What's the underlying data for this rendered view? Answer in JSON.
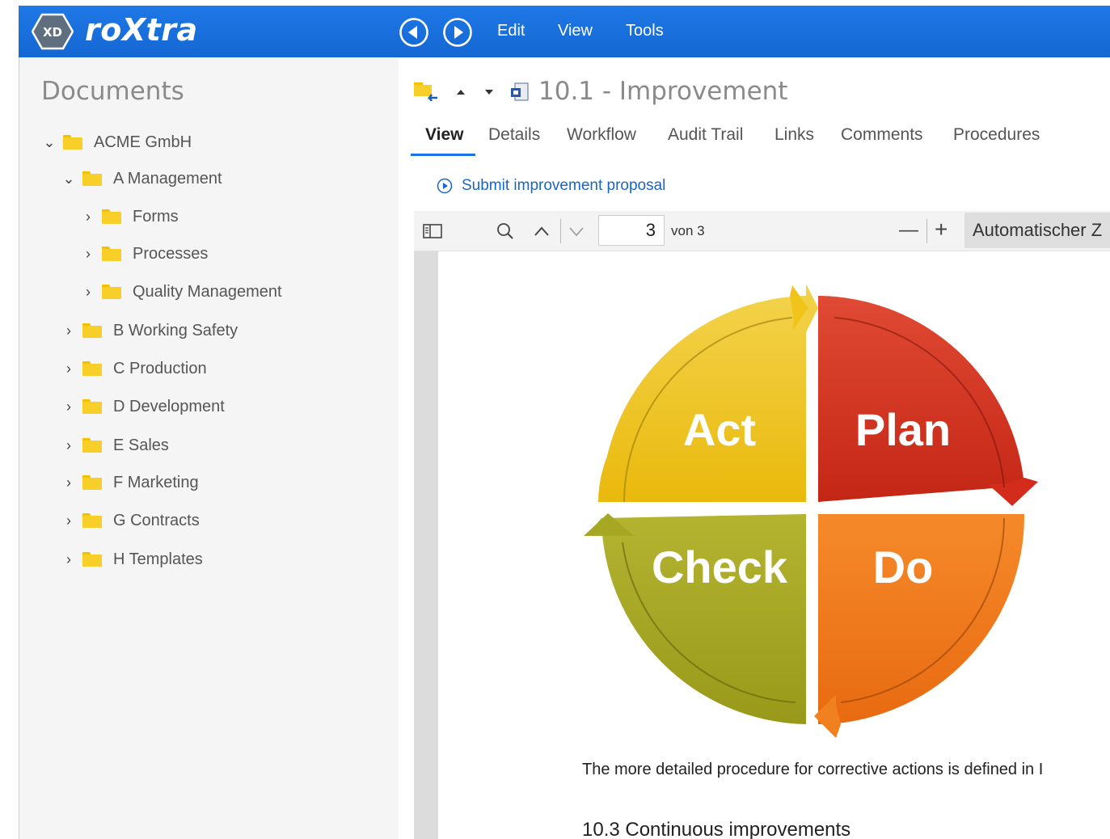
{
  "app": {
    "logo_badge": "XD",
    "logo_text": "roXtra",
    "menu": [
      "Edit",
      "View",
      "Tools"
    ]
  },
  "sidebar": {
    "title": "Documents",
    "tree": [
      {
        "label": "ACME GmbH",
        "expanded": true
      },
      {
        "label": "A Management",
        "expanded": true
      },
      {
        "label": "Forms",
        "expanded": false
      },
      {
        "label": "Processes",
        "expanded": false
      },
      {
        "label": "Quality Management",
        "expanded": false
      },
      {
        "label": "B Working Safety",
        "expanded": false
      },
      {
        "label": "C Production",
        "expanded": false
      },
      {
        "label": "D Development",
        "expanded": false
      },
      {
        "label": "E Sales",
        "expanded": false
      },
      {
        "label": "F Marketing",
        "expanded": false
      },
      {
        "label": "G Contracts",
        "expanded": false
      },
      {
        "label": "H Templates",
        "expanded": false
      }
    ]
  },
  "document": {
    "title": "10.1 - Improvement",
    "tabs": [
      "View",
      "Details",
      "Workflow",
      "Audit Trail",
      "Links",
      "Comments",
      "Procedures"
    ],
    "active_tab": "View",
    "action_link": "Submit improvement proposal"
  },
  "viewer": {
    "page_current": "3",
    "page_total_label": "von 3",
    "zoom_label": "Automatischer Z",
    "zoom_minus": "—",
    "zoom_plus": "+",
    "cycle": {
      "act": "Act",
      "plan": "Plan",
      "check": "Check",
      "do": "Do"
    },
    "paragraph": "The more detailed procedure for corrective actions is defined in I",
    "section_heading": "10.3 Continuous improvements"
  },
  "colors": {
    "topbar": "#1a73e8",
    "act": "#f0c419",
    "plan": "#d42c1c",
    "check": "#a6a824",
    "do": "#f1801e"
  }
}
